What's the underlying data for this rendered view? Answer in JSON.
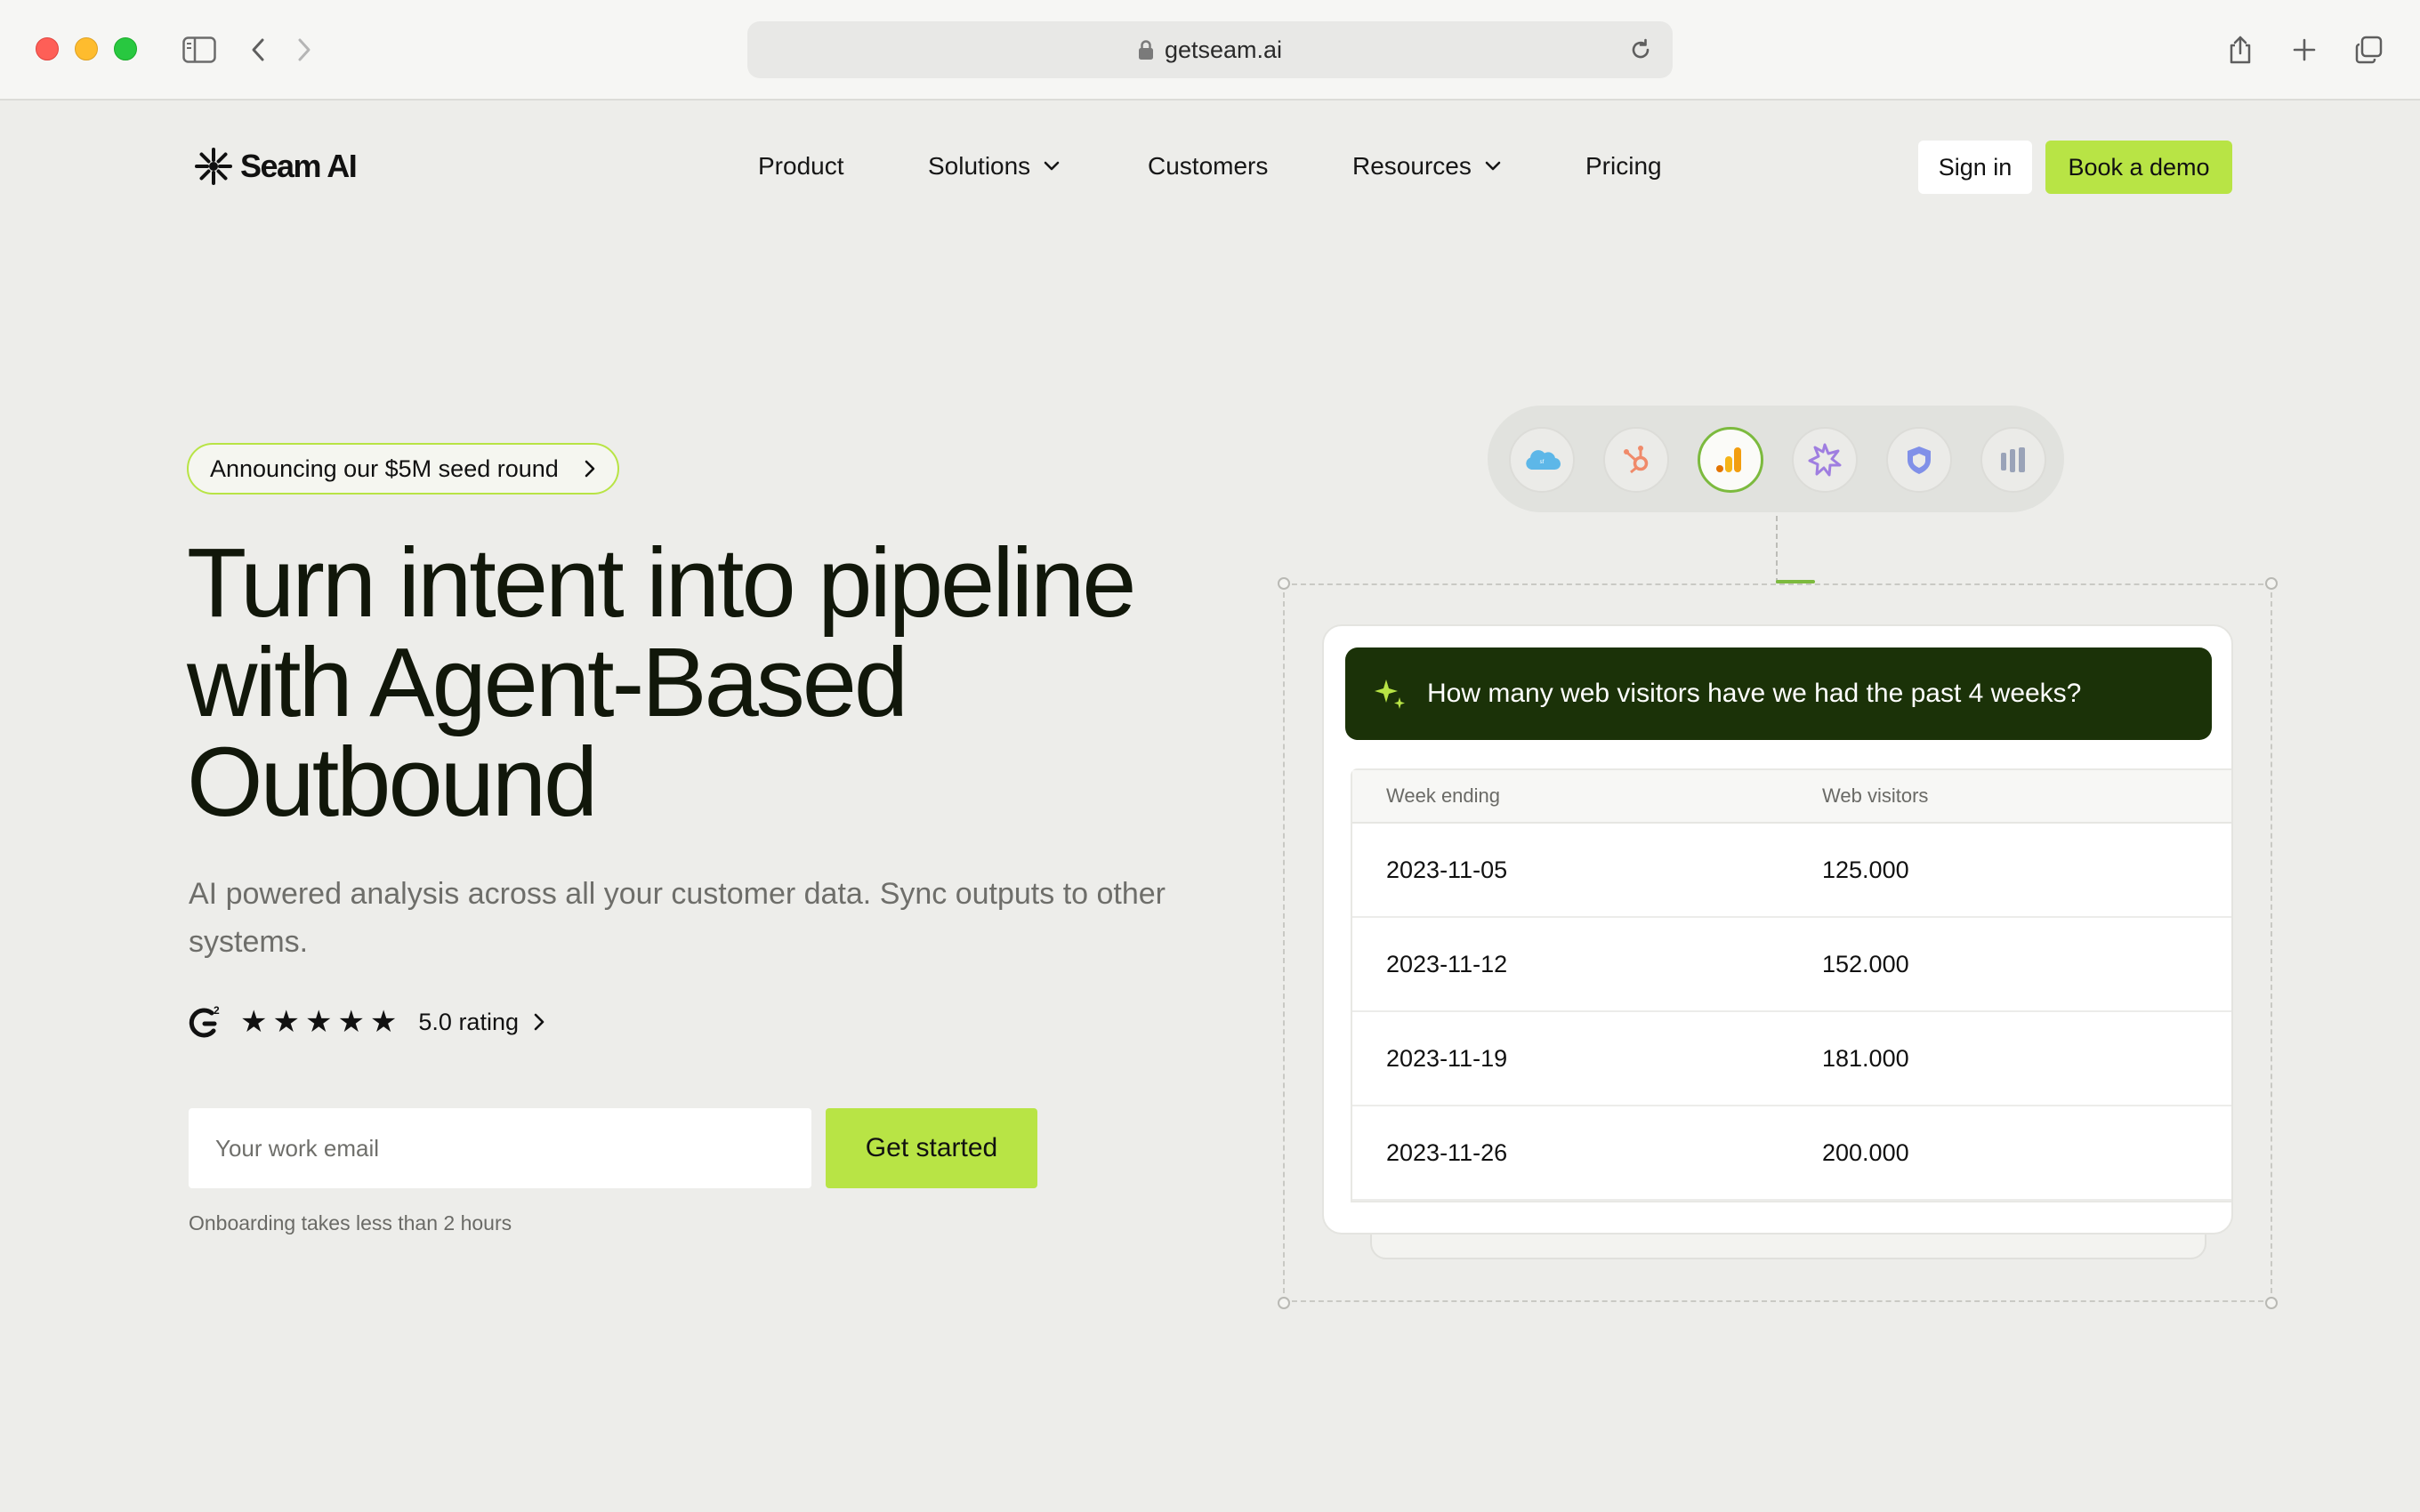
{
  "browser": {
    "url": "getseam.ai"
  },
  "nav": {
    "logo": "Seam AI",
    "items": [
      "Product",
      "Solutions",
      "Customers",
      "Resources",
      "Pricing"
    ],
    "sign_in": "Sign in",
    "book_demo": "Book a demo"
  },
  "hero": {
    "announcement": "Announcing our $5M seed round",
    "headline": [
      "Turn intent into pipeline",
      "with Agent-Based",
      "Outbound"
    ],
    "subtitle": "AI powered analysis across all your customer data. Sync outputs to other systems.",
    "stars": "★★★★★",
    "rating": "5.0 rating",
    "email_placeholder": "Your work email",
    "cta": "Get started",
    "onboarding_note": "Onboarding takes less than 2 hours"
  },
  "integrations": {
    "icons": [
      "salesforce-icon",
      "hubspot-icon",
      "google-analytics-icon",
      "starburst-icon",
      "shield-icon",
      "bars-icon"
    ],
    "active": "google-analytics-icon",
    "colors": {
      "salesforce": "#5db7e8",
      "hubspot": "#f08a6a",
      "analytics": "#f29d0f",
      "starburst": "#9f7ee0",
      "shield": "#8090e8",
      "bars": "#9aa3b8"
    }
  },
  "demo_card": {
    "question": "How many web visitors have we had the past 4 weeks?",
    "columns": [
      "Week ending",
      "Web visitors"
    ],
    "rows": [
      [
        "2023-11-05",
        "125.000"
      ],
      [
        "2023-11-12",
        "152.000"
      ],
      [
        "2023-11-19",
        "181.000"
      ],
      [
        "2023-11-26",
        "200.000"
      ]
    ]
  },
  "colors": {
    "background": "#ededea",
    "accent": "#b8e445",
    "question_bg": "#1b3208",
    "headline": "#11170a"
  }
}
